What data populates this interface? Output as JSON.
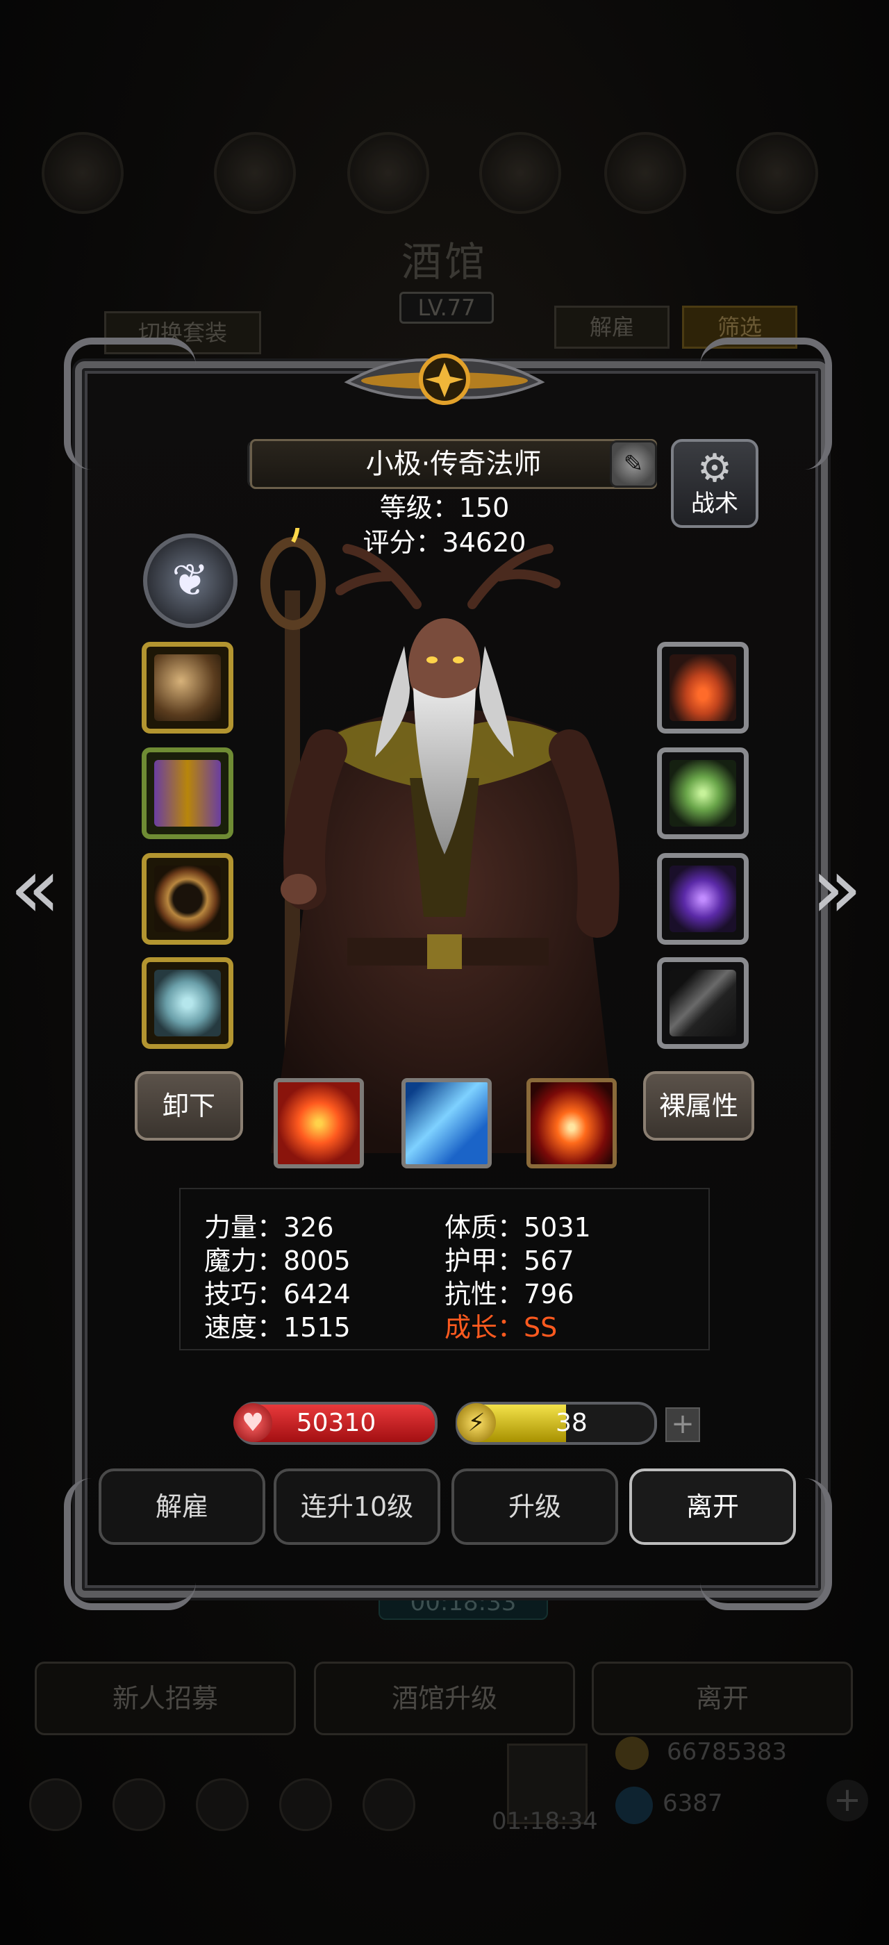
{
  "background": {
    "title": "酒馆",
    "level": "LV.77",
    "switch_outfit": "切换套装",
    "dismiss": "解雇",
    "filter": "筛选",
    "timer": "00:18:33",
    "bottom_buttons": [
      "新人招募",
      "酒馆升级",
      "离开"
    ],
    "gold_amount": "66785383",
    "gem_amount": "6387",
    "gift_timer": "01:18:34"
  },
  "hero": {
    "name": "小极·传奇法师",
    "level_text": "等级：150",
    "score_text": "评分：34620",
    "tactics_label": "战术"
  },
  "actions": {
    "unequip": "卸下",
    "naked_attr": "裸属性"
  },
  "attributes": {
    "left": [
      "力量：326",
      "魔力：8005",
      "技巧：6424",
      "速度：1515"
    ],
    "right": [
      "体质：5031",
      "护甲：567",
      "抗性：796",
      "成长：SS"
    ]
  },
  "bars": {
    "hp": "50310",
    "energy": "38",
    "energy_fraction": 0.55
  },
  "dialog_buttons": {
    "dismiss": "解雇",
    "level_up_10": "连升10级",
    "level_up": "升级",
    "leave": "离开"
  },
  "colors": {
    "growth_highlight": "#ff5a1f",
    "hp_bar": "#c8191b",
    "energy_bar": "#d7c400",
    "gold_slot_border": "#b39530",
    "green_slot_border": "#6f8c34",
    "silver_slot_border": "#8a8b8f"
  },
  "icons": {
    "prev": "chevron-double-left-icon",
    "next": "chevron-double-right-icon",
    "tactics": "gear-icon",
    "hp": "heart-icon",
    "energy": "lightning-icon",
    "add": "plus-icon"
  }
}
